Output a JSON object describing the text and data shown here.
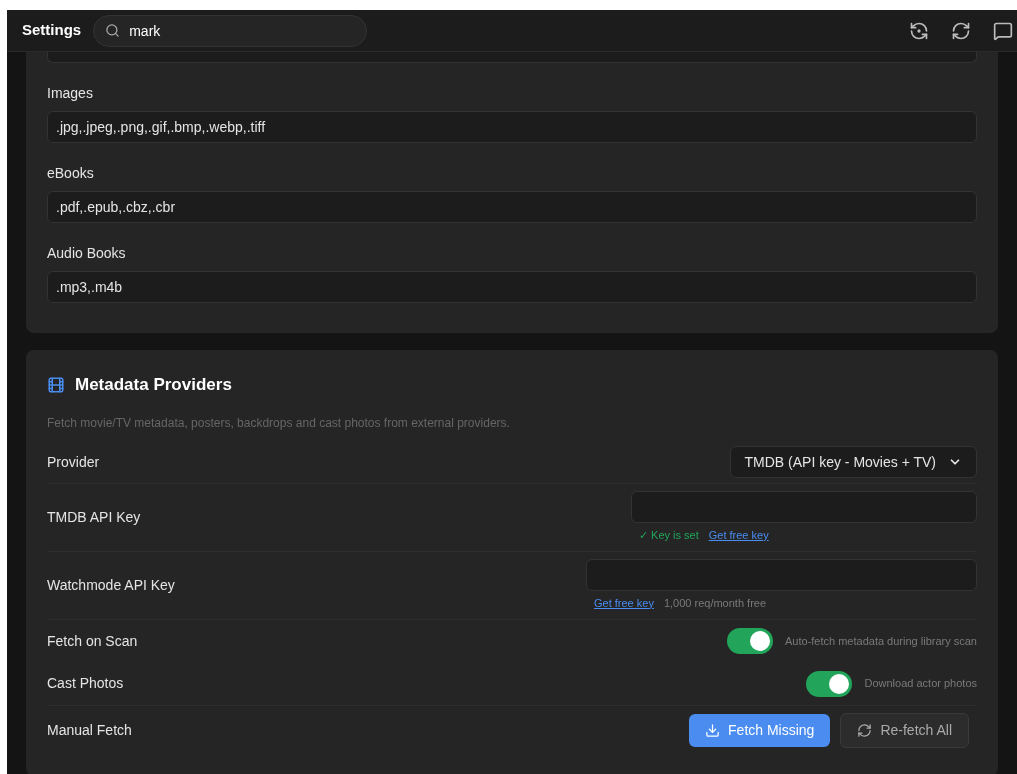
{
  "header": {
    "title": "Settings",
    "search": {
      "value": "mark"
    }
  },
  "file_types": [
    {
      "label": "Images",
      "value": ".jpg,.jpeg,.png,.gif,.bmp,.webp,.tiff"
    },
    {
      "label": "eBooks",
      "value": ".pdf,.epub,.cbz,.cbr"
    },
    {
      "label": "Audio Books",
      "value": ".mp3,.m4b"
    }
  ],
  "metadata": {
    "title": "Metadata Providers",
    "description": "Fetch movie/TV metadata, posters, backdrops and cast photos from external providers.",
    "rows": [
      {
        "kind": "select",
        "label": "Provider",
        "value": "TMDB (API key - Movies + TV)"
      },
      {
        "kind": "key",
        "label": "TMDB API Key",
        "status": "✓ Key is set",
        "link": "Get free key"
      },
      {
        "kind": "key",
        "label": "Watchmode API Key",
        "link": "Get free key",
        "note": "1,000 req/month free"
      },
      {
        "kind": "toggle",
        "label": "Fetch on Scan",
        "on": true,
        "hint": "Auto-fetch metadata during library scan"
      },
      {
        "kind": "toggle",
        "label": "Cast Photos",
        "on": true,
        "hint": "Download actor photos"
      },
      {
        "kind": "buttons",
        "label": "Manual Fetch",
        "primary": "Fetch Missing",
        "secondary": "Re-fetch All"
      }
    ]
  }
}
